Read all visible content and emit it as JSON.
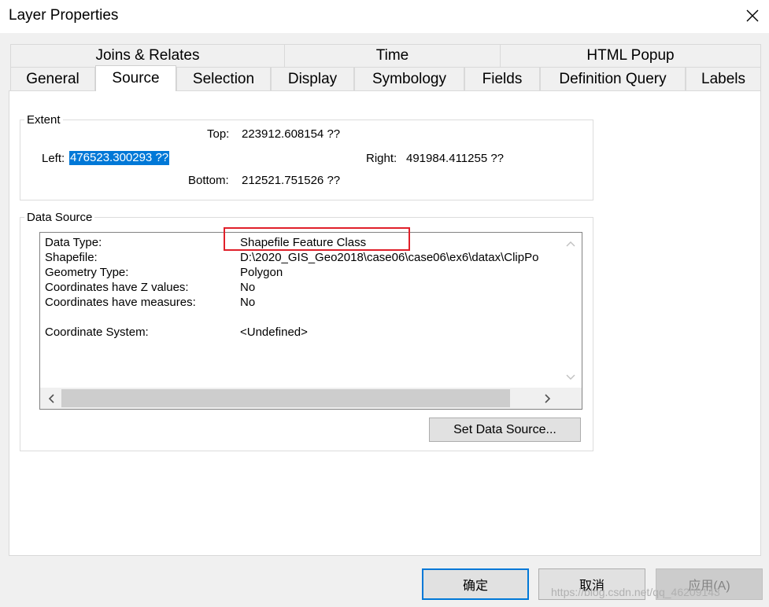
{
  "window": {
    "title": "Layer Properties"
  },
  "tabs": {
    "row1": [
      "Joins & Relates",
      "Time",
      "HTML Popup"
    ],
    "row2": [
      "General",
      "Source",
      "Selection",
      "Display",
      "Symbology",
      "Fields",
      "Definition Query",
      "Labels"
    ],
    "active": "Source"
  },
  "extent": {
    "legend": "Extent",
    "top_label": "Top:",
    "top_value": "223912.608154 ??",
    "left_label": "Left:",
    "left_value": "476523.300293 ??",
    "right_label": "Right:",
    "right_value": "491984.411255 ??",
    "bottom_label": "Bottom:",
    "bottom_value": "212521.751526 ??"
  },
  "data_source": {
    "legend": "Data Source",
    "rows": [
      {
        "label": "Data Type:",
        "value": "Shapefile Feature Class"
      },
      {
        "label": "Shapefile:",
        "value": "D:\\2020_GIS_Geo2018\\case06\\case06\\ex6\\datax\\ClipPo"
      },
      {
        "label": "Geometry Type:",
        "value": "Polygon"
      },
      {
        "label": "Coordinates have Z values:",
        "value": "No"
      },
      {
        "label": "Coordinates have measures:",
        "value": "No"
      },
      {
        "label": "Coordinate System:",
        "value": "<Undefined>"
      }
    ],
    "set_button": "Set Data Source..."
  },
  "footer": {
    "ok": "确定",
    "cancel": "取消",
    "apply": "应用(A)"
  },
  "watermark": "https://blog.csdn.net/qq_46209143",
  "colors": {
    "selection": "#0078d7",
    "highlight_box": "#e0202a",
    "ok_border": "#0078d7"
  }
}
